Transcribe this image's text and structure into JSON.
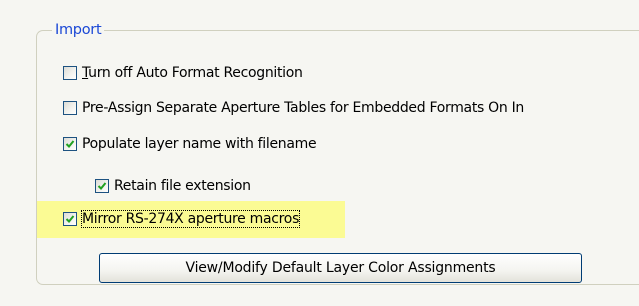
{
  "import_group": {
    "legend": "Import",
    "options": [
      {
        "id": "turn-off-auto-format",
        "label_accel": "T",
        "label_rest": "urn off Auto Format Recognition",
        "checked": false
      },
      {
        "id": "pre-assign-aperture",
        "label": "Pre-Assign Separate Aperture Tables for Embedded Formats On In",
        "checked": false
      },
      {
        "id": "populate-layer-name",
        "label": "Populate layer name with filename",
        "checked": true
      },
      {
        "id": "retain-file-extension",
        "label": "Retain file extension",
        "checked": true
      },
      {
        "id": "mirror-rs274x",
        "label": "Mirror RS-274X aperture macros",
        "checked": true
      }
    ],
    "button_label": "View/Modify Default Layer Color Assignments"
  },
  "colors": {
    "legend_text": "#1b48d6",
    "highlight": "#fbfb94",
    "check_mark": "#21a121",
    "checkbox_border": "#1d5281"
  }
}
